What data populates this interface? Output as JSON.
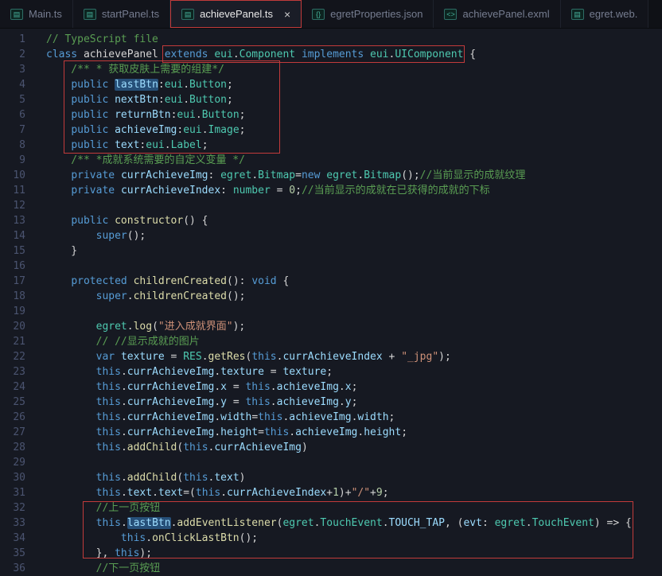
{
  "colors": {
    "annotation_red": "#c23b3b",
    "word_highlight": "#264f78",
    "editor_background": "#161922"
  },
  "tabs": [
    {
      "label": "Main.ts",
      "icon": "ts-file-icon",
      "icon_glyph": "▤",
      "active": false
    },
    {
      "label": "startPanel.ts",
      "icon": "ts-file-icon",
      "icon_glyph": "▤",
      "active": false
    },
    {
      "label": "achievePanel.ts",
      "icon": "ts-file-icon",
      "icon_glyph": "▤",
      "active": true,
      "close_label": "×"
    },
    {
      "label": "egretProperties.json",
      "icon": "json-file-icon",
      "icon_glyph": "{}",
      "active": false
    },
    {
      "label": "achievePanel.exml",
      "icon": "xml-file-icon",
      "icon_glyph": "<>",
      "active": false
    },
    {
      "label": "egret.web.",
      "icon": "ts-file-icon",
      "icon_glyph": "▤",
      "active": false
    }
  ],
  "editor": {
    "language": "TypeScript",
    "lines": [
      {
        "n": 1,
        "tokens": [
          [
            "// TypeScript file",
            "com"
          ]
        ]
      },
      {
        "n": 2,
        "tokens": [
          [
            "class ",
            "kw"
          ],
          [
            "achievePanel ",
            "pln"
          ],
          [
            "extends ",
            "kw"
          ],
          [
            "eui",
            "typ"
          ],
          [
            ".",
            "pun"
          ],
          [
            "Component ",
            "typ"
          ],
          [
            "implements ",
            "kw"
          ],
          [
            "eui",
            "typ"
          ],
          [
            ".",
            "pun"
          ],
          [
            "UIComponent ",
            "typ"
          ],
          [
            "{",
            "pun"
          ]
        ]
      },
      {
        "n": 3,
        "tokens": [
          [
            "    /** * 获取皮肤上需要的组建*/",
            "com"
          ]
        ]
      },
      {
        "n": 4,
        "tokens": [
          [
            "    ",
            "pln"
          ],
          [
            "public ",
            "kw"
          ],
          [
            "lastBtn",
            "ident hl"
          ],
          [
            ":",
            "pun"
          ],
          [
            "eui",
            "typ"
          ],
          [
            ".",
            "pun"
          ],
          [
            "Button",
            "typ"
          ],
          [
            ";",
            "pun"
          ]
        ]
      },
      {
        "n": 5,
        "tokens": [
          [
            "    ",
            "pln"
          ],
          [
            "public ",
            "kw"
          ],
          [
            "nextBtn",
            "ident"
          ],
          [
            ":",
            "pun"
          ],
          [
            "eui",
            "typ"
          ],
          [
            ".",
            "pun"
          ],
          [
            "Button",
            "typ"
          ],
          [
            ";",
            "pun"
          ]
        ]
      },
      {
        "n": 6,
        "tokens": [
          [
            "    ",
            "pln"
          ],
          [
            "public ",
            "kw"
          ],
          [
            "returnBtn",
            "ident"
          ],
          [
            ":",
            "pun"
          ],
          [
            "eui",
            "typ"
          ],
          [
            ".",
            "pun"
          ],
          [
            "Button",
            "typ"
          ],
          [
            ";",
            "pun"
          ]
        ]
      },
      {
        "n": 7,
        "tokens": [
          [
            "    ",
            "pln"
          ],
          [
            "public ",
            "kw"
          ],
          [
            "achieveImg",
            "ident"
          ],
          [
            ":",
            "pun"
          ],
          [
            "eui",
            "typ"
          ],
          [
            ".",
            "pun"
          ],
          [
            "Image",
            "typ"
          ],
          [
            ";",
            "pun"
          ]
        ]
      },
      {
        "n": 8,
        "tokens": [
          [
            "    ",
            "pln"
          ],
          [
            "public ",
            "kw"
          ],
          [
            "text",
            "ident"
          ],
          [
            ":",
            "pun"
          ],
          [
            "eui",
            "typ"
          ],
          [
            ".",
            "pun"
          ],
          [
            "Label",
            "typ"
          ],
          [
            ";",
            "pun"
          ]
        ]
      },
      {
        "n": 9,
        "tokens": [
          [
            "    /** *成就系统需要的自定义变量 */",
            "com"
          ]
        ]
      },
      {
        "n": 10,
        "tokens": [
          [
            "    ",
            "pln"
          ],
          [
            "private ",
            "kw"
          ],
          [
            "currAchieveImg",
            "ident"
          ],
          [
            ": ",
            "pun"
          ],
          [
            "egret",
            "typ"
          ],
          [
            ".",
            "pun"
          ],
          [
            "Bitmap",
            "typ"
          ],
          [
            "=",
            "pun"
          ],
          [
            "new ",
            "kw"
          ],
          [
            "egret",
            "typ"
          ],
          [
            ".",
            "pun"
          ],
          [
            "Bitmap",
            "typ"
          ],
          [
            "();",
            "pun"
          ],
          [
            "//当前显示的成就纹理",
            "com"
          ]
        ]
      },
      {
        "n": 11,
        "tokens": [
          [
            "    ",
            "pln"
          ],
          [
            "private ",
            "kw"
          ],
          [
            "currAchieveIndex",
            "ident"
          ],
          [
            ": ",
            "pun"
          ],
          [
            "number",
            "typ"
          ],
          [
            " = ",
            "pun"
          ],
          [
            "0",
            "num"
          ],
          [
            ";",
            "pun"
          ],
          [
            "//当前显示的成就在已获得的成就的下标",
            "com"
          ]
        ]
      },
      {
        "n": 12,
        "tokens": []
      },
      {
        "n": 13,
        "tokens": [
          [
            "    ",
            "pln"
          ],
          [
            "public ",
            "kw"
          ],
          [
            "constructor",
            "fn"
          ],
          [
            "() {",
            "pun"
          ]
        ]
      },
      {
        "n": 14,
        "tokens": [
          [
            "        ",
            "pln"
          ],
          [
            "super",
            "kw"
          ],
          [
            "();",
            "pun"
          ]
        ]
      },
      {
        "n": 15,
        "tokens": [
          [
            "    }",
            "pun"
          ]
        ]
      },
      {
        "n": 16,
        "tokens": []
      },
      {
        "n": 17,
        "tokens": [
          [
            "    ",
            "pln"
          ],
          [
            "protected ",
            "kw"
          ],
          [
            "childrenCreated",
            "fn"
          ],
          [
            "(): ",
            "pun"
          ],
          [
            "void",
            "kw"
          ],
          [
            " {",
            "pun"
          ]
        ]
      },
      {
        "n": 18,
        "tokens": [
          [
            "        ",
            "pln"
          ],
          [
            "super",
            "kw"
          ],
          [
            ".",
            "pun"
          ],
          [
            "childrenCreated",
            "fn"
          ],
          [
            "();",
            "pun"
          ]
        ]
      },
      {
        "n": 19,
        "tokens": []
      },
      {
        "n": 20,
        "tokens": [
          [
            "        ",
            "pln"
          ],
          [
            "egret",
            "typ"
          ],
          [
            ".",
            "pun"
          ],
          [
            "log",
            "fn"
          ],
          [
            "(",
            "pun"
          ],
          [
            "\"进入成就界面\"",
            "str"
          ],
          [
            ");",
            "pun"
          ]
        ]
      },
      {
        "n": 21,
        "tokens": [
          [
            "        // //显示成就的图片",
            "com"
          ]
        ]
      },
      {
        "n": 22,
        "tokens": [
          [
            "        ",
            "pln"
          ],
          [
            "var ",
            "kw"
          ],
          [
            "texture",
            "ident"
          ],
          [
            " = ",
            "pun"
          ],
          [
            "RES",
            "typ"
          ],
          [
            ".",
            "pun"
          ],
          [
            "getRes",
            "fn"
          ],
          [
            "(",
            "pun"
          ],
          [
            "this",
            "kw"
          ],
          [
            ".",
            "pun"
          ],
          [
            "currAchieveIndex",
            "ident"
          ],
          [
            " + ",
            "pun"
          ],
          [
            "\"_jpg\"",
            "str"
          ],
          [
            ");",
            "pun"
          ]
        ]
      },
      {
        "n": 23,
        "tokens": [
          [
            "        ",
            "pln"
          ],
          [
            "this",
            "kw"
          ],
          [
            ".",
            "pun"
          ],
          [
            "currAchieveImg",
            "ident"
          ],
          [
            ".",
            "pun"
          ],
          [
            "texture",
            "ident"
          ],
          [
            " = ",
            "pun"
          ],
          [
            "texture",
            "ident"
          ],
          [
            ";",
            "pun"
          ]
        ]
      },
      {
        "n": 24,
        "tokens": [
          [
            "        ",
            "pln"
          ],
          [
            "this",
            "kw"
          ],
          [
            ".",
            "pun"
          ],
          [
            "currAchieveImg",
            "ident"
          ],
          [
            ".",
            "pun"
          ],
          [
            "x",
            "ident"
          ],
          [
            " = ",
            "pun"
          ],
          [
            "this",
            "kw"
          ],
          [
            ".",
            "pun"
          ],
          [
            "achieveImg",
            "ident"
          ],
          [
            ".",
            "pun"
          ],
          [
            "x",
            "ident"
          ],
          [
            ";",
            "pun"
          ]
        ]
      },
      {
        "n": 25,
        "tokens": [
          [
            "        ",
            "pln"
          ],
          [
            "this",
            "kw"
          ],
          [
            ".",
            "pun"
          ],
          [
            "currAchieveImg",
            "ident"
          ],
          [
            ".",
            "pun"
          ],
          [
            "y",
            "ident"
          ],
          [
            " = ",
            "pun"
          ],
          [
            "this",
            "kw"
          ],
          [
            ".",
            "pun"
          ],
          [
            "achieveImg",
            "ident"
          ],
          [
            ".",
            "pun"
          ],
          [
            "y",
            "ident"
          ],
          [
            ";",
            "pun"
          ]
        ]
      },
      {
        "n": 26,
        "tokens": [
          [
            "        ",
            "pln"
          ],
          [
            "this",
            "kw"
          ],
          [
            ".",
            "pun"
          ],
          [
            "currAchieveImg",
            "ident"
          ],
          [
            ".",
            "pun"
          ],
          [
            "width",
            "ident"
          ],
          [
            "=",
            "pun"
          ],
          [
            "this",
            "kw"
          ],
          [
            ".",
            "pun"
          ],
          [
            "achieveImg",
            "ident"
          ],
          [
            ".",
            "pun"
          ],
          [
            "width",
            "ident"
          ],
          [
            ";",
            "pun"
          ]
        ]
      },
      {
        "n": 27,
        "tokens": [
          [
            "        ",
            "pln"
          ],
          [
            "this",
            "kw"
          ],
          [
            ".",
            "pun"
          ],
          [
            "currAchieveImg",
            "ident"
          ],
          [
            ".",
            "pun"
          ],
          [
            "height",
            "ident"
          ],
          [
            "=",
            "pun"
          ],
          [
            "this",
            "kw"
          ],
          [
            ".",
            "pun"
          ],
          [
            "achieveImg",
            "ident"
          ],
          [
            ".",
            "pun"
          ],
          [
            "height",
            "ident"
          ],
          [
            ";",
            "pun"
          ]
        ]
      },
      {
        "n": 28,
        "tokens": [
          [
            "        ",
            "pln"
          ],
          [
            "this",
            "kw"
          ],
          [
            ".",
            "pun"
          ],
          [
            "addChild",
            "fn"
          ],
          [
            "(",
            "pun"
          ],
          [
            "this",
            "kw"
          ],
          [
            ".",
            "pun"
          ],
          [
            "currAchieveImg",
            "ident"
          ],
          [
            ")",
            "pun"
          ]
        ]
      },
      {
        "n": 29,
        "tokens": []
      },
      {
        "n": 30,
        "tokens": [
          [
            "        ",
            "pln"
          ],
          [
            "this",
            "kw"
          ],
          [
            ".",
            "pun"
          ],
          [
            "addChild",
            "fn"
          ],
          [
            "(",
            "pun"
          ],
          [
            "this",
            "kw"
          ],
          [
            ".",
            "pun"
          ],
          [
            "text",
            "ident"
          ],
          [
            ")",
            "pun"
          ]
        ]
      },
      {
        "n": 31,
        "tokens": [
          [
            "        ",
            "pln"
          ],
          [
            "this",
            "kw"
          ],
          [
            ".",
            "pun"
          ],
          [
            "text",
            "ident"
          ],
          [
            ".",
            "pun"
          ],
          [
            "text",
            "ident"
          ],
          [
            "=(",
            "pun"
          ],
          [
            "this",
            "kw"
          ],
          [
            ".",
            "pun"
          ],
          [
            "currAchieveIndex",
            "ident"
          ],
          [
            "+",
            "pun"
          ],
          [
            "1",
            "num"
          ],
          [
            ")+",
            "pun"
          ],
          [
            "\"/\"",
            "str"
          ],
          [
            "+",
            "pun"
          ],
          [
            "9",
            "num"
          ],
          [
            ";",
            "pun"
          ]
        ]
      },
      {
        "n": 32,
        "tokens": [
          [
            "        //上一页按钮",
            "com"
          ]
        ]
      },
      {
        "n": 33,
        "tokens": [
          [
            "        ",
            "pln"
          ],
          [
            "this",
            "kw"
          ],
          [
            ".",
            "pun"
          ],
          [
            "lastBtn",
            "ident hl"
          ],
          [
            ".",
            "pun"
          ],
          [
            "addEventListener",
            "fn"
          ],
          [
            "(",
            "pun"
          ],
          [
            "egret",
            "typ"
          ],
          [
            ".",
            "pun"
          ],
          [
            "TouchEvent",
            "typ"
          ],
          [
            ".",
            "pun"
          ],
          [
            "TOUCH_TAP",
            "ident"
          ],
          [
            ", (",
            "pun"
          ],
          [
            "evt",
            "ident"
          ],
          [
            ": ",
            "pun"
          ],
          [
            "egret",
            "typ"
          ],
          [
            ".",
            "pun"
          ],
          [
            "TouchEvent",
            "typ"
          ],
          [
            ") => {",
            "pun"
          ]
        ]
      },
      {
        "n": 34,
        "tokens": [
          [
            "            ",
            "pln"
          ],
          [
            "this",
            "kw"
          ],
          [
            ".",
            "pun"
          ],
          [
            "onClickLastBtn",
            "fn"
          ],
          [
            "();",
            "pun"
          ]
        ]
      },
      {
        "n": 35,
        "tokens": [
          [
            "        }, ",
            "pun"
          ],
          [
            "this",
            "kw"
          ],
          [
            ");",
            "pun"
          ]
        ]
      },
      {
        "n": 36,
        "tokens": [
          [
            "        //下一页按钮",
            "com"
          ]
        ]
      }
    ]
  },
  "annotations": [
    {
      "name": "annotation-active-tab",
      "target": "achievePanel.ts tab"
    },
    {
      "name": "annotation-class-signature",
      "target": "extends eui.Component implements eui.UIComponent"
    },
    {
      "name": "annotation-skin-members",
      "target": "lines 3-8 public member declarations"
    },
    {
      "name": "annotation-lastbtn-listener",
      "target": "lines 32-35 lastBtn addEventListener block"
    }
  ]
}
